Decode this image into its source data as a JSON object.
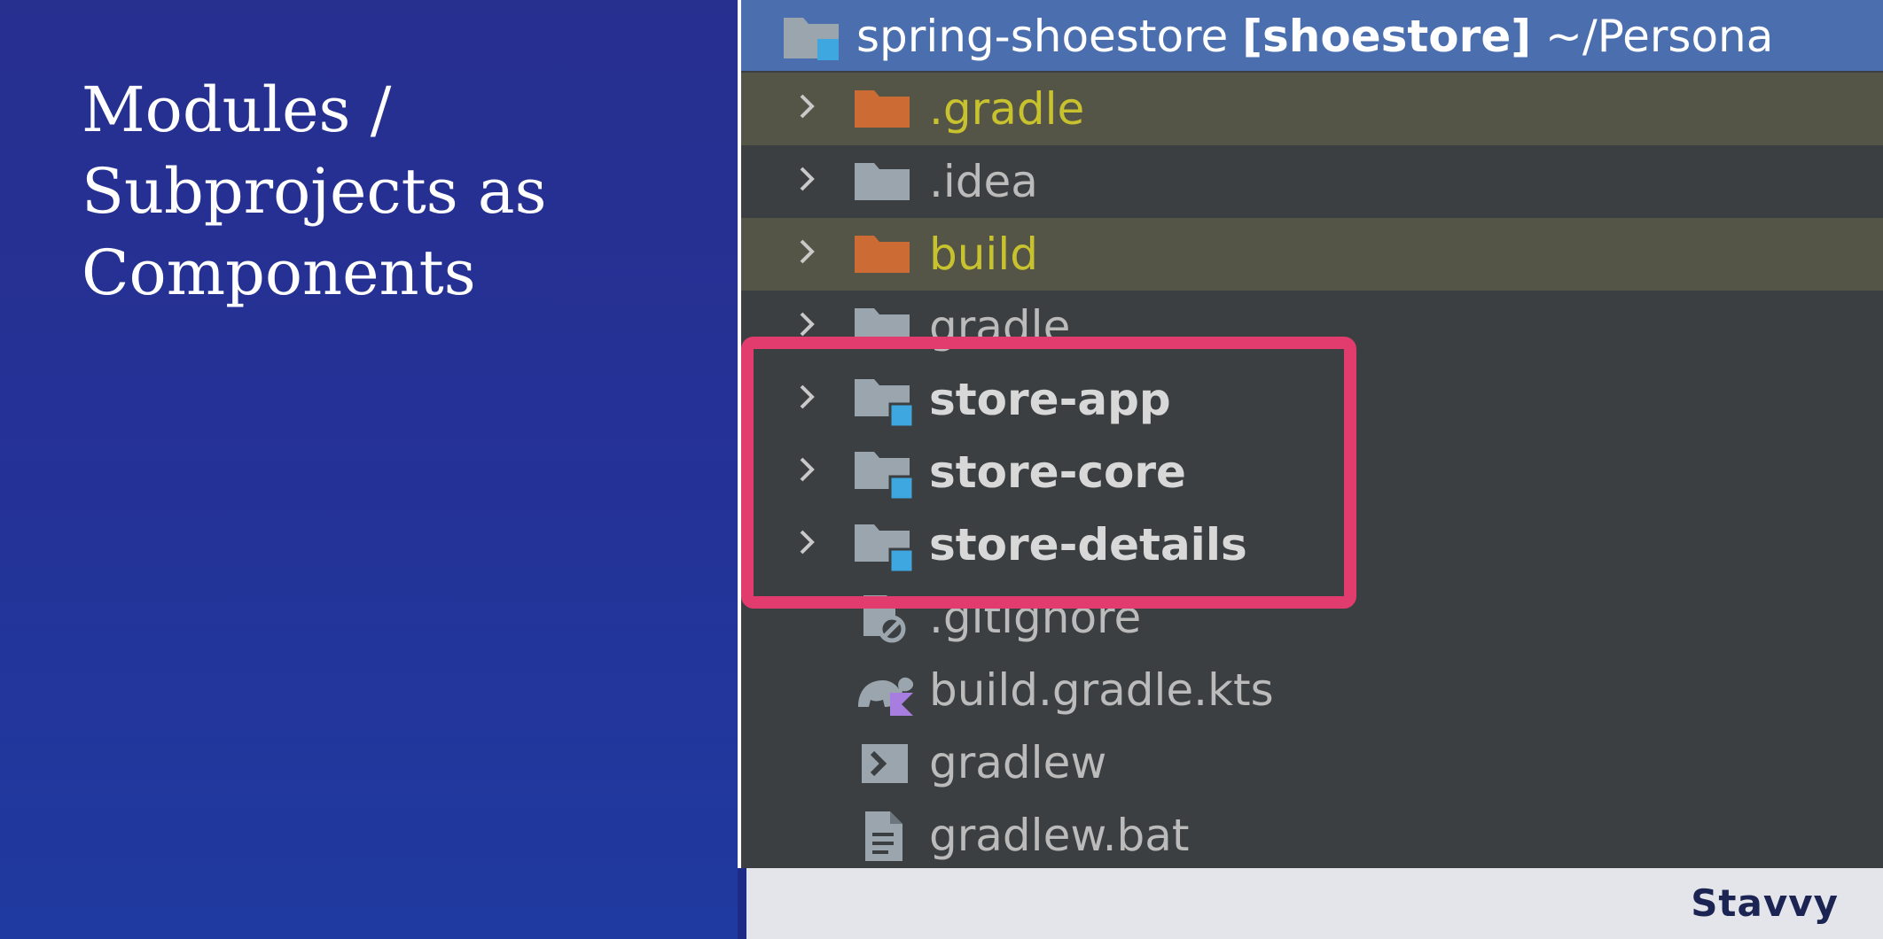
{
  "slide": {
    "title_lines": [
      "Modules /",
      "Subprojects as",
      "Components"
    ]
  },
  "project": {
    "name": "spring-shoestore",
    "module": "[shoestore]",
    "path": "~/Persona"
  },
  "tree": {
    "gradle_dir": ".gradle",
    "idea_dir": ".idea",
    "build_dir": "build",
    "gradle_wrapper_dir": "gradle",
    "store_app": "store-app",
    "store_core": "store-core",
    "store_details": "store-details",
    "gitignore": ".gitignore",
    "build_script": "build.gradle.kts",
    "gradlew": "gradlew",
    "gradlew_bat": "gradlew.bat"
  },
  "colors": {
    "excluded_folder": "#cc6b33",
    "folder": "#9aa5ad",
    "module_badge": "#3fa7e0",
    "highlight_border": "#e23c6e",
    "selection": "#4b6eaf"
  },
  "branding": {
    "logo": "Stavvy"
  }
}
